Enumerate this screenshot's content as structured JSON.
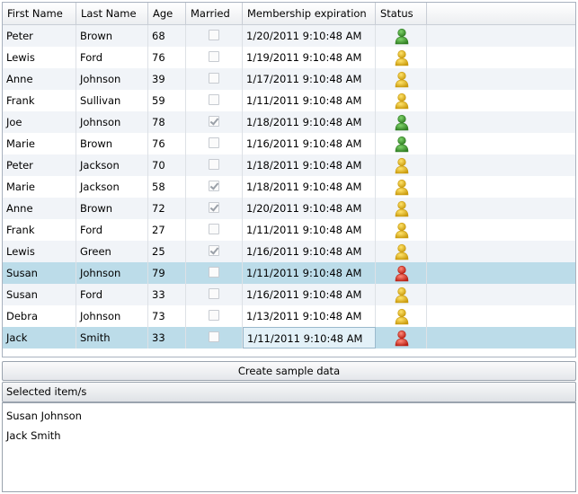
{
  "grid": {
    "columns": [
      "First Name",
      "Last Name",
      "Age",
      "Married",
      "Membership expiration",
      "Status"
    ],
    "rows": [
      {
        "first": "Peter",
        "last": "Brown",
        "age": "68",
        "married": false,
        "expiration": "1/20/2011 9:10:48 AM",
        "status": "green",
        "selected": false
      },
      {
        "first": "Lewis",
        "last": "Ford",
        "age": "76",
        "married": false,
        "expiration": "1/19/2011 9:10:48 AM",
        "status": "yellow",
        "selected": false
      },
      {
        "first": "Anne",
        "last": "Johnson",
        "age": "39",
        "married": false,
        "expiration": "1/17/2011 9:10:48 AM",
        "status": "yellow",
        "selected": false
      },
      {
        "first": "Frank",
        "last": "Sullivan",
        "age": "59",
        "married": false,
        "expiration": "1/11/2011 9:10:48 AM",
        "status": "yellow",
        "selected": false
      },
      {
        "first": "Joe",
        "last": "Johnson",
        "age": "78",
        "married": true,
        "expiration": "1/18/2011 9:10:48 AM",
        "status": "green",
        "selected": false
      },
      {
        "first": "Marie",
        "last": "Brown",
        "age": "76",
        "married": false,
        "expiration": "1/16/2011 9:10:48 AM",
        "status": "green",
        "selected": false
      },
      {
        "first": "Peter",
        "last": "Jackson",
        "age": "70",
        "married": false,
        "expiration": "1/18/2011 9:10:48 AM",
        "status": "yellow",
        "selected": false
      },
      {
        "first": "Marie",
        "last": "Jackson",
        "age": "58",
        "married": true,
        "expiration": "1/18/2011 9:10:48 AM",
        "status": "yellow",
        "selected": false
      },
      {
        "first": "Anne",
        "last": "Brown",
        "age": "72",
        "married": true,
        "expiration": "1/20/2011 9:10:48 AM",
        "status": "yellow",
        "selected": false
      },
      {
        "first": "Frank",
        "last": "Ford",
        "age": "27",
        "married": false,
        "expiration": "1/11/2011 9:10:48 AM",
        "status": "yellow",
        "selected": false
      },
      {
        "first": "Lewis",
        "last": "Green",
        "age": "25",
        "married": true,
        "expiration": "1/16/2011 9:10:48 AM",
        "status": "yellow",
        "selected": false
      },
      {
        "first": "Susan",
        "last": "Johnson",
        "age": "79",
        "married": false,
        "expiration": "1/11/2011 9:10:48 AM",
        "status": "red",
        "selected": true
      },
      {
        "first": "Susan",
        "last": "Ford",
        "age": "33",
        "married": false,
        "expiration": "1/16/2011 9:10:48 AM",
        "status": "yellow",
        "selected": false
      },
      {
        "first": "Debra",
        "last": "Johnson",
        "age": "73",
        "married": false,
        "expiration": "1/13/2011 9:10:48 AM",
        "status": "yellow",
        "selected": false
      },
      {
        "first": "Jack",
        "last": "Smith",
        "age": "33",
        "married": false,
        "expiration": "1/11/2011 9:10:48 AM",
        "status": "red",
        "selected": true,
        "current": true
      }
    ]
  },
  "create_button_label": "Create sample data",
  "selected_panel": {
    "title": "Selected item/s",
    "items": [
      "Susan Johnson",
      "Jack Smith"
    ]
  },
  "status_colors": {
    "green": {
      "light": "#7ed36a",
      "dark": "#2f7d22"
    },
    "yellow": {
      "light": "#ffe36a",
      "dark": "#c99a0c"
    },
    "red": {
      "light": "#ff8a7a",
      "dark": "#b81e12"
    }
  },
  "selection_color": "#bcdce9"
}
